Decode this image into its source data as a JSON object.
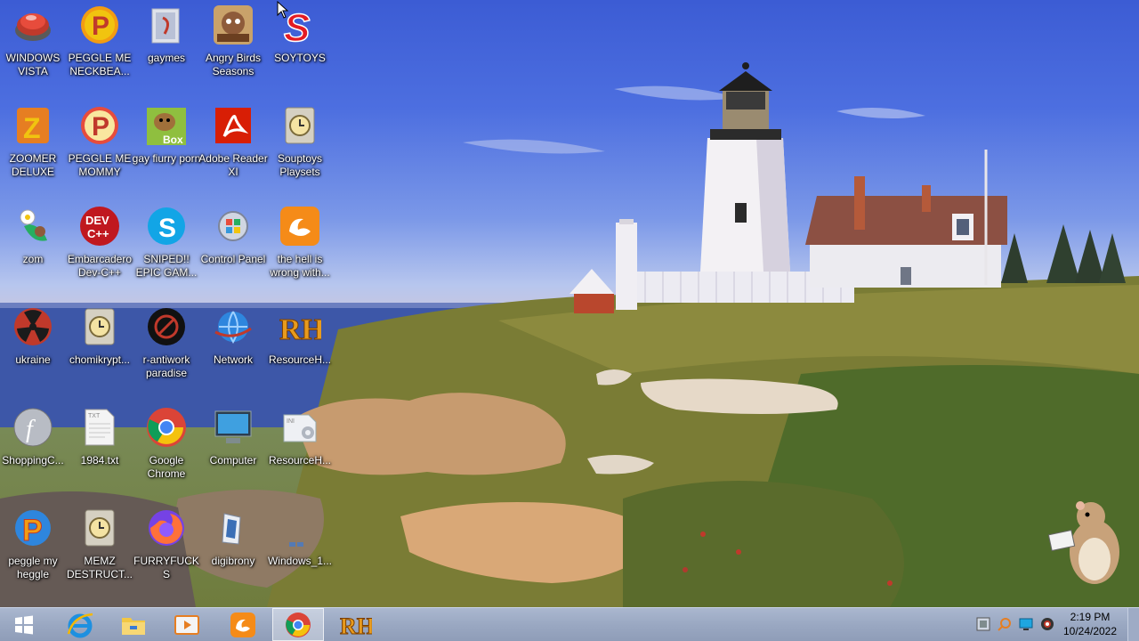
{
  "desktop": {
    "icons": [
      {
        "label": "WINDOWS VISTA",
        "icon": "windows-vista-icon"
      },
      {
        "label": "PEGGLE ME NECKBEA...",
        "icon": "peggle-icon"
      },
      {
        "label": "gaymes",
        "icon": "folder-icon"
      },
      {
        "label": "Angry Birds Seasons",
        "icon": "angry-birds-icon"
      },
      {
        "label": "SOYTOYS",
        "icon": "soytoys-icon"
      },
      {
        "label": "ZOOMER DELUXE",
        "icon": "zoomer-icon"
      },
      {
        "label": "PEGGLE ME MOMMY",
        "icon": "peggle-icon"
      },
      {
        "label": "gay fiurry porn",
        "icon": "box-gopher-icon"
      },
      {
        "label": "Adobe Reader XI",
        "icon": "adobe-reader-icon"
      },
      {
        "label": "Souptoys Playsets",
        "icon": "clock-file-icon"
      },
      {
        "label": "zom",
        "icon": "zom-icon"
      },
      {
        "label": "Embarcadero Dev-C++",
        "icon": "devcpp-icon"
      },
      {
        "label": "SNIPED!! EPIC GAM...",
        "icon": "skype-icon"
      },
      {
        "label": "Control Panel",
        "icon": "control-panel-icon"
      },
      {
        "label": "the hell is wrong with...",
        "icon": "uc-browser-icon"
      },
      {
        "label": "ukraine",
        "icon": "radiation-icon"
      },
      {
        "label": "chomikrypt...",
        "icon": "clock-file-icon"
      },
      {
        "label": "r-antiwork paradise",
        "icon": "antiwork-icon"
      },
      {
        "label": "Network",
        "icon": "network-icon"
      },
      {
        "label": "ResourceH...",
        "icon": "resource-hacker-icon"
      },
      {
        "label": "ShoppingC...",
        "icon": "flash-icon"
      },
      {
        "label": "1984.txt",
        "icon": "text-file-icon"
      },
      {
        "label": "Google Chrome",
        "icon": "chrome-icon"
      },
      {
        "label": "Computer",
        "icon": "computer-icon"
      },
      {
        "label": "ResourceH...",
        "icon": "ini-file-icon"
      },
      {
        "label": "peggle my heggle",
        "icon": "peggle-p-icon"
      },
      {
        "label": "MEMZ DESTRUCT...",
        "icon": "clock-file-icon"
      },
      {
        "label": "FURRYFUCKS",
        "icon": "firefox-icon"
      },
      {
        "label": "digibrony",
        "icon": "digibrony-icon"
      },
      {
        "label": "Windows_1...",
        "icon": "windows-logo-icon"
      }
    ]
  },
  "taskbar": {
    "items": [
      {
        "name": "internet-explorer",
        "icon": "ie-icon"
      },
      {
        "name": "file-explorer",
        "icon": "folder-icon"
      },
      {
        "name": "media-player",
        "icon": "media-player-icon"
      },
      {
        "name": "uc-browser",
        "icon": "uc-browser-icon"
      },
      {
        "name": "google-chrome",
        "icon": "chrome-icon",
        "active": true
      },
      {
        "name": "resource-hacker",
        "icon": "resource-hacker-icon"
      }
    ],
    "tray": {
      "time": "2:19 PM",
      "date": "10/24/2022"
    }
  },
  "colors": {
    "taskbar": "#9aa8c2",
    "label_text": "#ffffff"
  }
}
